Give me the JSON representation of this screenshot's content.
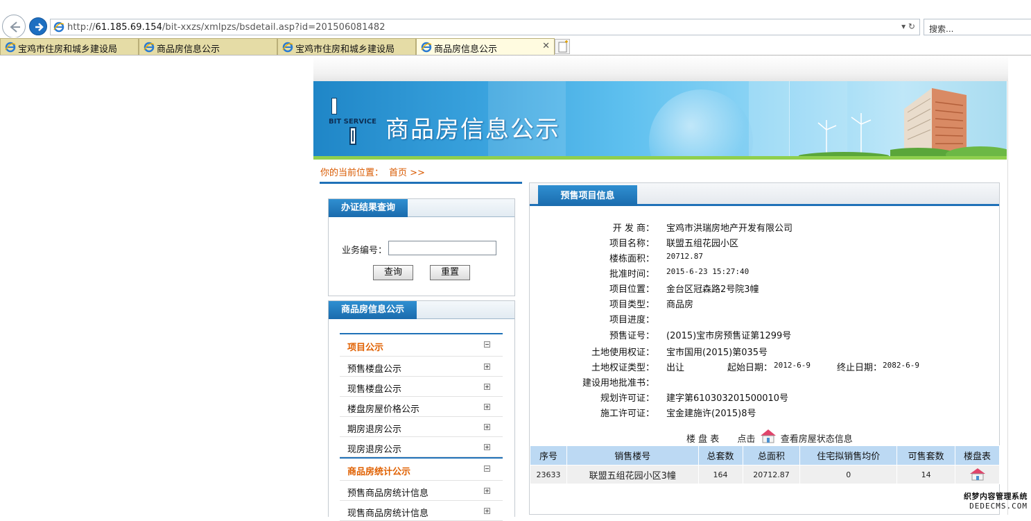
{
  "browser": {
    "url_prefix": "http://",
    "url_host": "61.185.69.154",
    "url_path": "/bit-xxzs/xmlpzs/bsdetail.asp?id=201506081482",
    "url_tools": "▾ ↻",
    "search_placeholder": "搜索...",
    "tabs": [
      {
        "label": "宝鸡市住房和城乡建设局",
        "active": false
      },
      {
        "label": "商品房信息公示",
        "active": false
      },
      {
        "label": "宝鸡市住房和城乡建设局",
        "active": false
      },
      {
        "label": "商品房信息公示",
        "active": true
      }
    ],
    "tab_close": "✕"
  },
  "banner": {
    "logo_text": "BIT SERVICE",
    "title": "商品房信息公示"
  },
  "breadcrumb": {
    "prefix": "你的当前位置：",
    "home": "首页 >>"
  },
  "query_box": {
    "title": "办证结果查询",
    "field_label": "业务编号：",
    "field_value": "",
    "search_label": "查询",
    "reset_label": "重置"
  },
  "info_menu": {
    "title": "商品房信息公示",
    "sections": [
      {
        "label": "项目公示",
        "items": [
          "预售楼盘公示",
          "现售楼盘公示",
          "楼盘房屋价格公示",
          "期房退房公示",
          "现房退房公示"
        ]
      },
      {
        "label": "商品房统计公示",
        "items": [
          "预售商品房统计信息",
          "现售商品房统计信息"
        ]
      }
    ]
  },
  "project": {
    "tab_title": "预售项目信息",
    "fields": [
      {
        "label": "开 发 商：",
        "value": "宝鸡市洪瑞房地产开发有限公司"
      },
      {
        "label": "项目名称：",
        "value": "联盟五组花园小区"
      },
      {
        "label": "楼栋面积：",
        "value": "20712.87"
      },
      {
        "label": "批准时间：",
        "value": "2015-6-23 15:27:40"
      },
      {
        "label": "项目位置：",
        "value": "金台区冠森路2号院3幢"
      },
      {
        "label": "项目类型：",
        "value": "商品房"
      },
      {
        "label": "项目进度：",
        "value": ""
      },
      {
        "label": "预售证号：",
        "value": "(2015)宝市房预售证第1299号"
      },
      {
        "label": "土地使用权证：",
        "value": "宝市国用(2015)第035号"
      },
      {
        "label": "土地权证类型：",
        "value": "出让"
      },
      {
        "label": "建设用地批准书：",
        "value": ""
      },
      {
        "label": "规划许可证：",
        "value": "建字第610303201500010号"
      },
      {
        "label": "施工许可证：",
        "value": "宝金建施许(2015)8号"
      }
    ],
    "start_label": "起始日期：",
    "start_value": "2012-6-9",
    "end_label": "终止日期：",
    "end_value": "2082-6-9",
    "lp_label": "楼 盘 表",
    "lp_click": "点击",
    "lp_view": "查看房屋状态信息"
  },
  "table": {
    "headers": [
      "序号",
      "销售楼号",
      "总套数",
      "总面积",
      "住宅拟销售均价",
      "可售套数",
      "楼盘表"
    ],
    "rows": [
      {
        "id": "23633",
        "building": "联盟五组花园小区3幢",
        "total_units": "164",
        "total_area": "20712.87",
        "avg_price": "0",
        "available": "14"
      }
    ]
  },
  "watermark": {
    "line1": "织梦内容管理系统",
    "line2": "DEDECMS.COM"
  },
  "colors": {
    "accent_blue": "#1f71b8",
    "breadcrumb_orange": "#d95a00",
    "table_header": "#bcd9f3",
    "tab_bg": "#e5dca6"
  }
}
